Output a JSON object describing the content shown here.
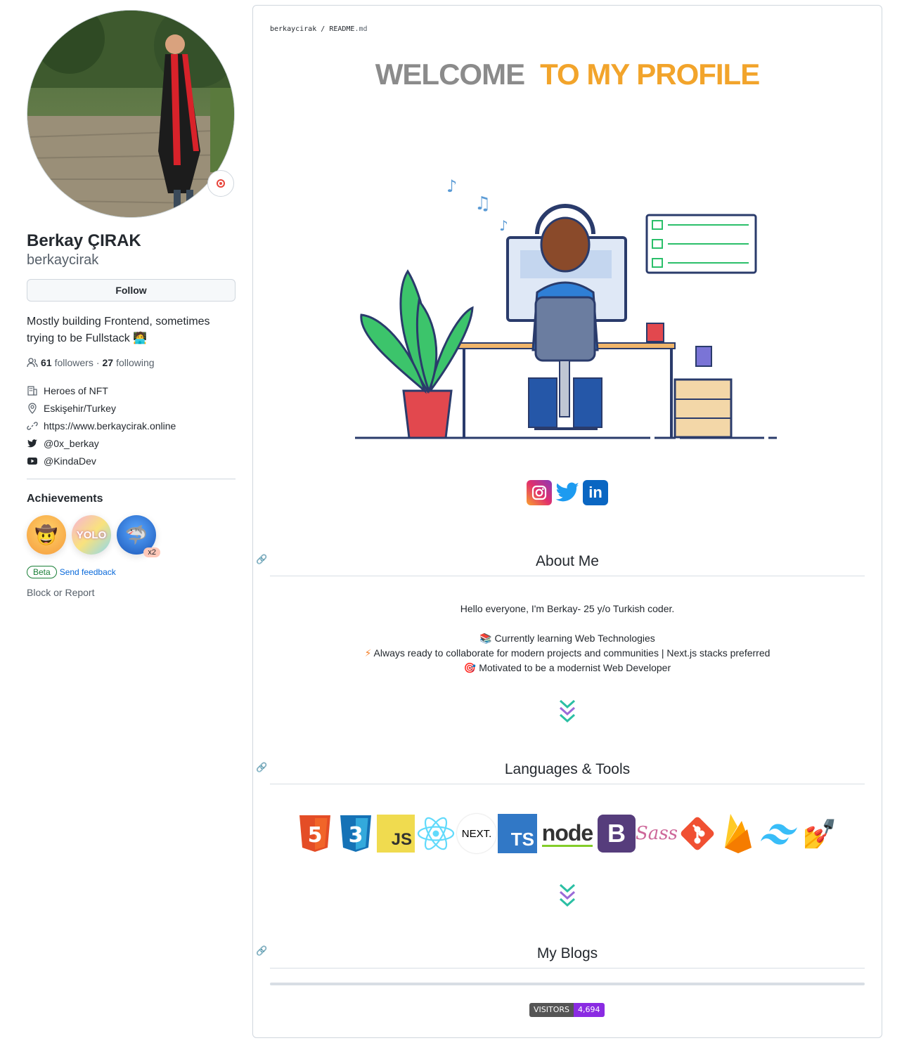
{
  "profile": {
    "full_name": "Berkay ÇIRAK",
    "username": "berkaycirak",
    "follow_label": "Follow",
    "bio": "Mostly building Frontend, sometimes trying to be Fullstack",
    "followers_count": "61",
    "followers_label": "followers",
    "separator": "·",
    "following_count": "27",
    "following_label": "following",
    "details": {
      "company": "Heroes of NFT",
      "location": "Eskişehir/Turkey",
      "website": "https://www.berkaycirak.online",
      "twitter": "@0x_berkay",
      "youtube": "@KindaDev"
    },
    "achievements_title": "Achievements",
    "achievement_multiplier": "x2",
    "beta_label": "Beta",
    "feedback_label": "Send feedback",
    "block_label": "Block or Report"
  },
  "readme": {
    "crumb_user": "berkaycirak",
    "crumb_sep": "/",
    "crumb_file": "README",
    "crumb_ext": ".md",
    "welcome_gray": "WELCOME",
    "welcome_orange": "TO MY PROFILE",
    "about_title": "About Me",
    "about_intro": "Hello everyone, I'm Berkay- 25 y/o Turkish coder.",
    "about_line1": "Currently learning Web Technologies",
    "about_line2": "Always ready to collaborate for modern projects and communities | Next.js stacks preferred",
    "about_line3": "Motivated to be a modernist Web Developer",
    "tools_title": "Languages & Tools",
    "tools": [
      "HTML5",
      "CSS3",
      "JS",
      "React",
      "Next.js",
      "TS",
      "node",
      "Bootstrap",
      "Sass",
      "Git",
      "Firebase",
      "Tailwind",
      "Nail"
    ],
    "tool_labels": {
      "js": "JS",
      "next": "NEXT.",
      "ts": "TS",
      "node": "node",
      "bootstrap": "B",
      "sass": "Sass"
    },
    "blogs_title": "My Blogs",
    "visitors_label": "VISITORS",
    "visitors_count": "4,694"
  }
}
